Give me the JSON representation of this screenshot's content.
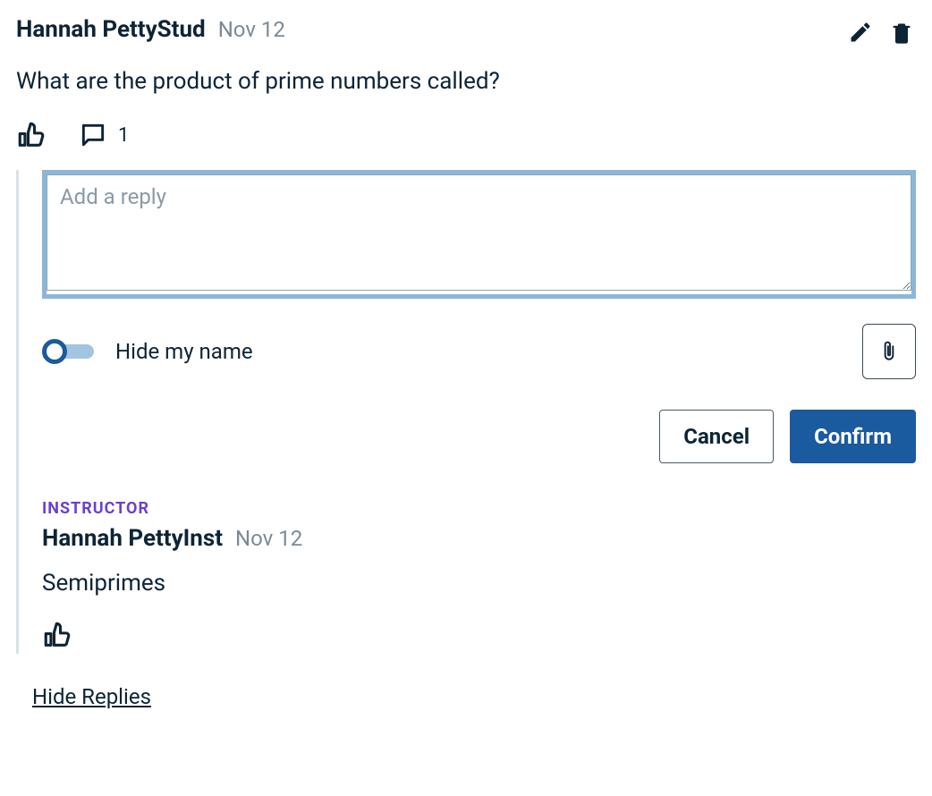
{
  "post": {
    "author": "Hannah PettyStud",
    "date": "Nov 12",
    "body": "What are the product of prime numbers called?",
    "comment_count": "1"
  },
  "reply_box": {
    "placeholder": "Add a reply",
    "hide_name_label": "Hide my name",
    "cancel_label": "Cancel",
    "confirm_label": "Confirm"
  },
  "replies": [
    {
      "role": "INSTRUCTOR",
      "author": "Hannah PettyInst",
      "date": "Nov 12",
      "body": "Semiprimes"
    }
  ],
  "hide_replies_label": "Hide Replies"
}
